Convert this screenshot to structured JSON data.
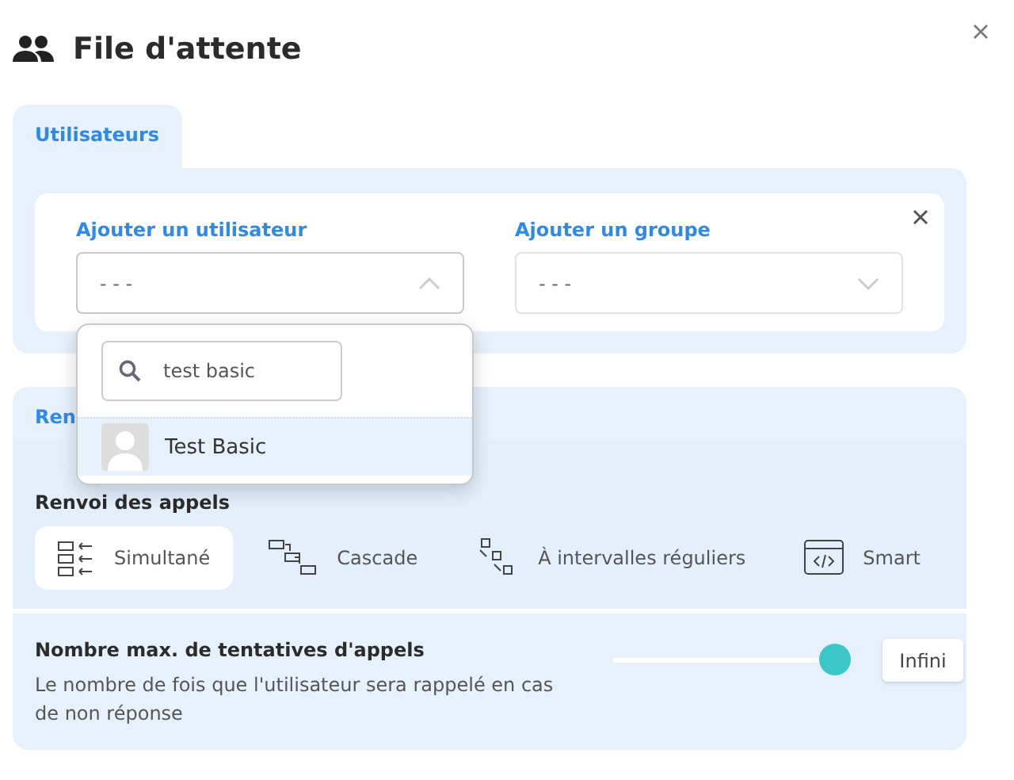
{
  "window": {
    "title": "File d'attente"
  },
  "tabs": [
    {
      "label": "Utilisateurs",
      "selected": true
    }
  ],
  "users_panel": {
    "user_label": "Ajouter un utilisateur",
    "user_select": {
      "value": "- - -",
      "expanded": true
    },
    "group_label": "Ajouter un groupe",
    "group_select": {
      "value": "- - -",
      "expanded": false
    }
  },
  "dropdown": {
    "search": {
      "value": "test basic"
    },
    "options": [
      {
        "label": "Test Basic",
        "selected": true
      }
    ]
  },
  "section": {
    "title": "Ren",
    "forward_label": "Renvoi des appels",
    "modes": [
      {
        "label": "Simultané",
        "kind": "simultaneous",
        "selected": true
      },
      {
        "label": "Cascade",
        "kind": "cascade",
        "selected": false
      },
      {
        "label": "À intervalles réguliers",
        "kind": "interval",
        "selected": false
      },
      {
        "label": "Smart",
        "kind": "smart",
        "selected": false
      }
    ],
    "attempts": {
      "title": "Nombre max. de tentatives d'appels",
      "description": "Le nombre de fois que l'utilisateur sera rappelé en cas de non réponse",
      "level": 1,
      "value": "Infini"
    }
  }
}
